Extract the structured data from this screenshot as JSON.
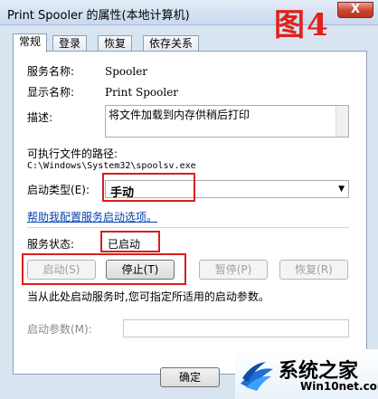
{
  "window": {
    "title": "Print Spooler 的属性(本地计算机)",
    "close_label": "X"
  },
  "figure_label": "图4",
  "tabs": [
    "常规",
    "登录",
    "恢复",
    "依存关系"
  ],
  "fields": {
    "service_name_label": "服务名称:",
    "service_name": "Spooler",
    "display_name_label": "显示名称:",
    "display_name": "Print Spooler",
    "description_label": "描述:",
    "description": "将文件加载到内存供稍后打印",
    "path_label": "可执行文件的路径:",
    "path": "C:\\Windows\\System32\\spoolsv.exe",
    "startup_type_label": "启动类型(E):",
    "startup_type": "手动",
    "help_link": "帮助我配置服务启动选项。",
    "status_label": "服务状态:",
    "status": "已启动"
  },
  "buttons": {
    "start": "启动(S)",
    "stop": "停止(T)",
    "pause": "暂停(P)",
    "resume": "恢复(R)"
  },
  "hint": "当从此处启动服务时,您可指定所适用的启动参数。",
  "start_params_label": "启动参数(M):",
  "ok_button": "确定",
  "watermark": {
    "title": "系统之家",
    "url": "Win10net.com"
  },
  "colors": {
    "annotation_red": "#d81e1e",
    "link": "#0645ad"
  }
}
